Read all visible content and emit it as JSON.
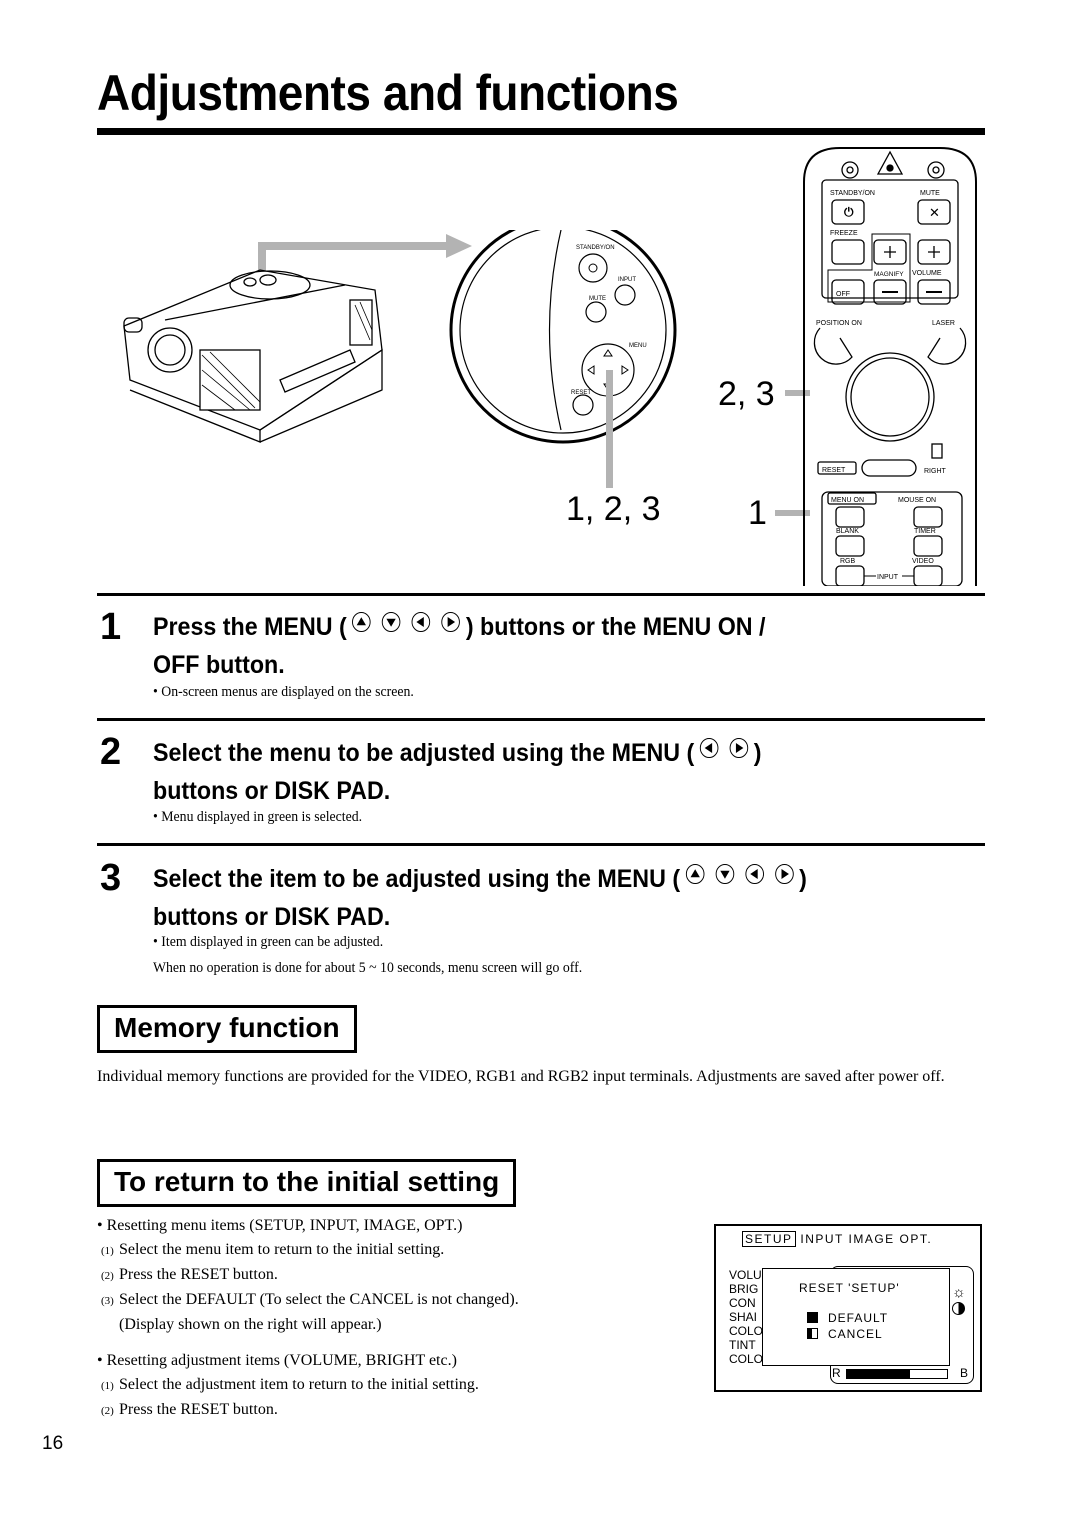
{
  "page": {
    "title": "Adjustments and functions",
    "page_number": "16"
  },
  "figure": {
    "callout_123": "1, 2, 3",
    "callout_23": "2, 3",
    "callout_1": "1",
    "control_panel": {
      "standby": "STANDBY/ON",
      "input": "INPUT",
      "mute": "MUTE",
      "menu": "MENU",
      "reset": "RESET"
    },
    "remote": {
      "standby": "STANDBY/ON",
      "mute": "MUTE",
      "freeze": "FREEZE",
      "magnify": "MAGNIFY",
      "volume": "VOLUME",
      "off": "OFF",
      "position_on": "POSITION  ON",
      "laser": "LASER",
      "reset": "RESET",
      "right": "RIGHT",
      "menu_on": "MENU  ON",
      "mouse_on": "MOUSE  ON",
      "blank": "BLANK",
      "timer": "TIMER",
      "rgb": "RGB",
      "video": "VIDEO",
      "input": "INPUT"
    }
  },
  "steps": [
    {
      "number": "1",
      "heading_a": "Press the MENU (",
      "heading_b": ") buttons or the MENU ON /",
      "heading_c": "OFF button.",
      "arrows": [
        "up",
        "down",
        "left",
        "right"
      ],
      "notes": [
        "• On-screen menus are displayed on the screen."
      ]
    },
    {
      "number": "2",
      "heading_a": "Select the menu to be adjusted using the MENU (",
      "heading_b": ")",
      "heading_c": "buttons or DISK PAD.",
      "arrows": [
        "left",
        "right"
      ],
      "notes": [
        "• Menu displayed  in green is selected."
      ]
    },
    {
      "number": "3",
      "heading_a": "Select the item to be adjusted using the MENU (",
      "heading_b": ")",
      "heading_c": "buttons or DISK PAD.",
      "arrows": [
        "up",
        "down",
        "left",
        "right"
      ],
      "notes": [
        "• Item displayed in green can be adjusted.",
        "When no operation is done for about 5 ~ 10 seconds, menu screen will go off."
      ]
    }
  ],
  "memory": {
    "heading": "Memory function",
    "body": "Individual memory functions are provided for the VIDEO, RGB1 and RGB2 input terminals. Adjustments are saved after power off."
  },
  "reset_section": {
    "heading": "To return to the initial setting",
    "group1": {
      "bullet": "• Resetting menu items (SETUP, INPUT, IMAGE, OPT.)",
      "steps": [
        {
          "n": "(1)",
          "text": "Select the menu item to return to the initial setting."
        },
        {
          "n": "(2)",
          "text": "Press the RESET  button."
        },
        {
          "n": "(3)",
          "text": "Select the DEFAULT (To select the CANCEL is not changed)."
        }
      ],
      "extra": "(Display shown on the right will appear.)"
    },
    "group2": {
      "bullet": "• Resetting adjustment items (VOLUME, BRIGHT etc.)",
      "steps": [
        {
          "n": "(1)",
          "text": "Select the adjustment item to return to the initial setting."
        },
        {
          "n": "(2)",
          "text": "Press the RESET button."
        }
      ]
    }
  },
  "osd": {
    "tabs": [
      "SETUP",
      "INPUT",
      "IMAGE",
      "OPT."
    ],
    "selected_tab": "SETUP",
    "items": [
      "VOLU",
      "BRIG",
      "CON",
      "SHAI",
      "COLO",
      "TINT",
      "COLOR BAL"
    ],
    "dialog_title": "RESET   'SETUP'",
    "options": [
      "DEFAULT",
      "CANCEL"
    ],
    "bar_left": "R",
    "bar_right": "B",
    "bar_fill_fraction": 0.63
  }
}
